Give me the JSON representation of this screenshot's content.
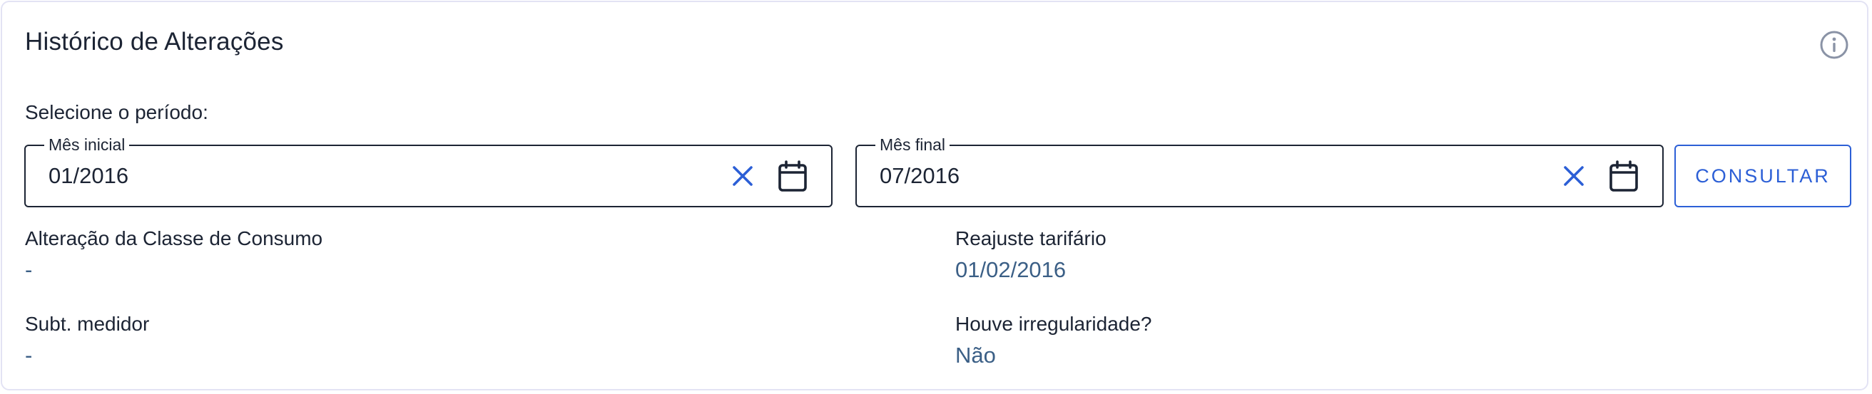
{
  "panel": {
    "title": "Histórico de Alterações"
  },
  "period": {
    "label": "Selecione o período:",
    "start": {
      "legend": "Mês inicial",
      "value": "01/2016"
    },
    "end": {
      "legend": "Mês final",
      "value": "07/2016"
    },
    "consult_label": "CONSULTAR"
  },
  "details": {
    "consumption_class": {
      "label": "Alteração da Classe de Consumo",
      "value": "-"
    },
    "tariff_adjustment": {
      "label": "Reajuste tarifário",
      "value": "01/02/2016"
    },
    "meter_substitution": {
      "label": "Subt. medidor",
      "value": "-"
    },
    "irregularity": {
      "label": "Houve irregularidade?",
      "value": "Não"
    }
  },
  "colors": {
    "accent": "#2c5fd6",
    "value_text": "#3b5f86",
    "border": "#1c2434",
    "info_icon": "#8a93a6"
  },
  "icons": {
    "info": "info-icon",
    "clear": "close-icon",
    "calendar": "calendar-icon"
  }
}
